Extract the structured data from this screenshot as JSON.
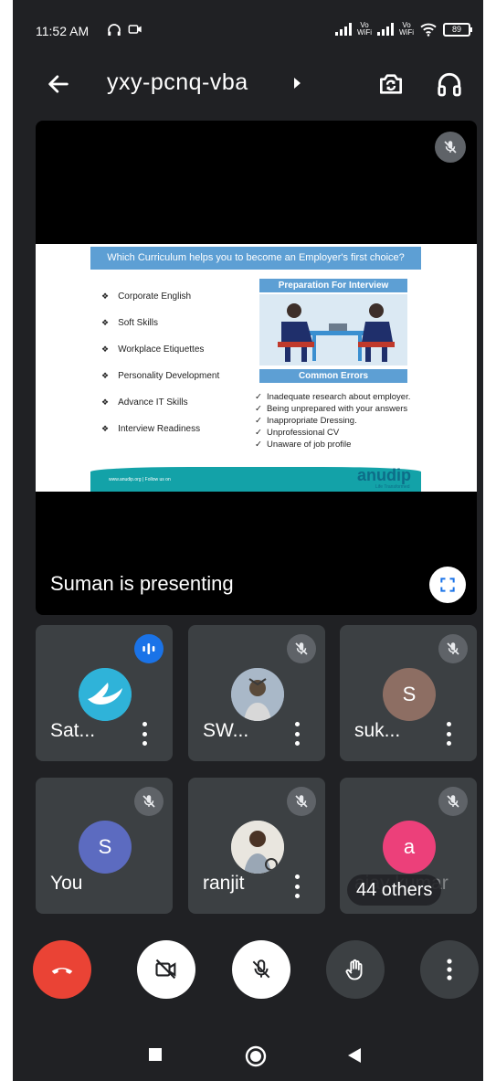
{
  "status_bar": {
    "time": "11:52 AM",
    "wifi_label_1": "Vo\nWiFi",
    "wifi_label_2": "Vo\nWiFi",
    "battery": "89"
  },
  "header": {
    "meeting_code": "yxy-pcnq-vba"
  },
  "presentation": {
    "presenting_label": "Suman is presenting",
    "slide": {
      "title": "Which Curriculum helps you to become an Employer's first choice?",
      "items": [
        "Corporate English",
        "Soft Skills",
        "Workplace Etiquettes",
        "Personality Development",
        "Advance IT Skills",
        "Interview Readiness"
      ],
      "box1_title": "Preparation For Interview",
      "box2_title": "Common Errors",
      "errors": [
        "Inadequate research about employer.",
        "Being unprepared with your answers",
        "Inappropriate Dressing.",
        "Unprofessional CV",
        "Unaware of job profile"
      ],
      "footer_url": "www.anudip.org | Follow us on",
      "logo": "anudip",
      "logo_sub": "Life Transformed"
    }
  },
  "participants": [
    {
      "name": "Sat...",
      "avatar_letter": "",
      "avatar_color": "#2fb3d9"
    },
    {
      "name": "SW...",
      "avatar_letter": "",
      "avatar_color": "#8a9bb0"
    },
    {
      "name": "suk...",
      "avatar_letter": "S",
      "avatar_color": "#8d6e63"
    },
    {
      "name": "You",
      "avatar_letter": "S",
      "avatar_color": "#5c6bc0"
    },
    {
      "name": "ranjit",
      "avatar_letter": "",
      "avatar_color": "#c9c9c9"
    },
    {
      "name": "ajay kumar",
      "avatar_letter": "a",
      "avatar_color": "#ec407a"
    }
  ],
  "others_label": "44 others",
  "colors": {
    "background": "#202124",
    "tile": "#3c4043",
    "end_call": "#ea4335",
    "speaking": "#1a73e8"
  }
}
